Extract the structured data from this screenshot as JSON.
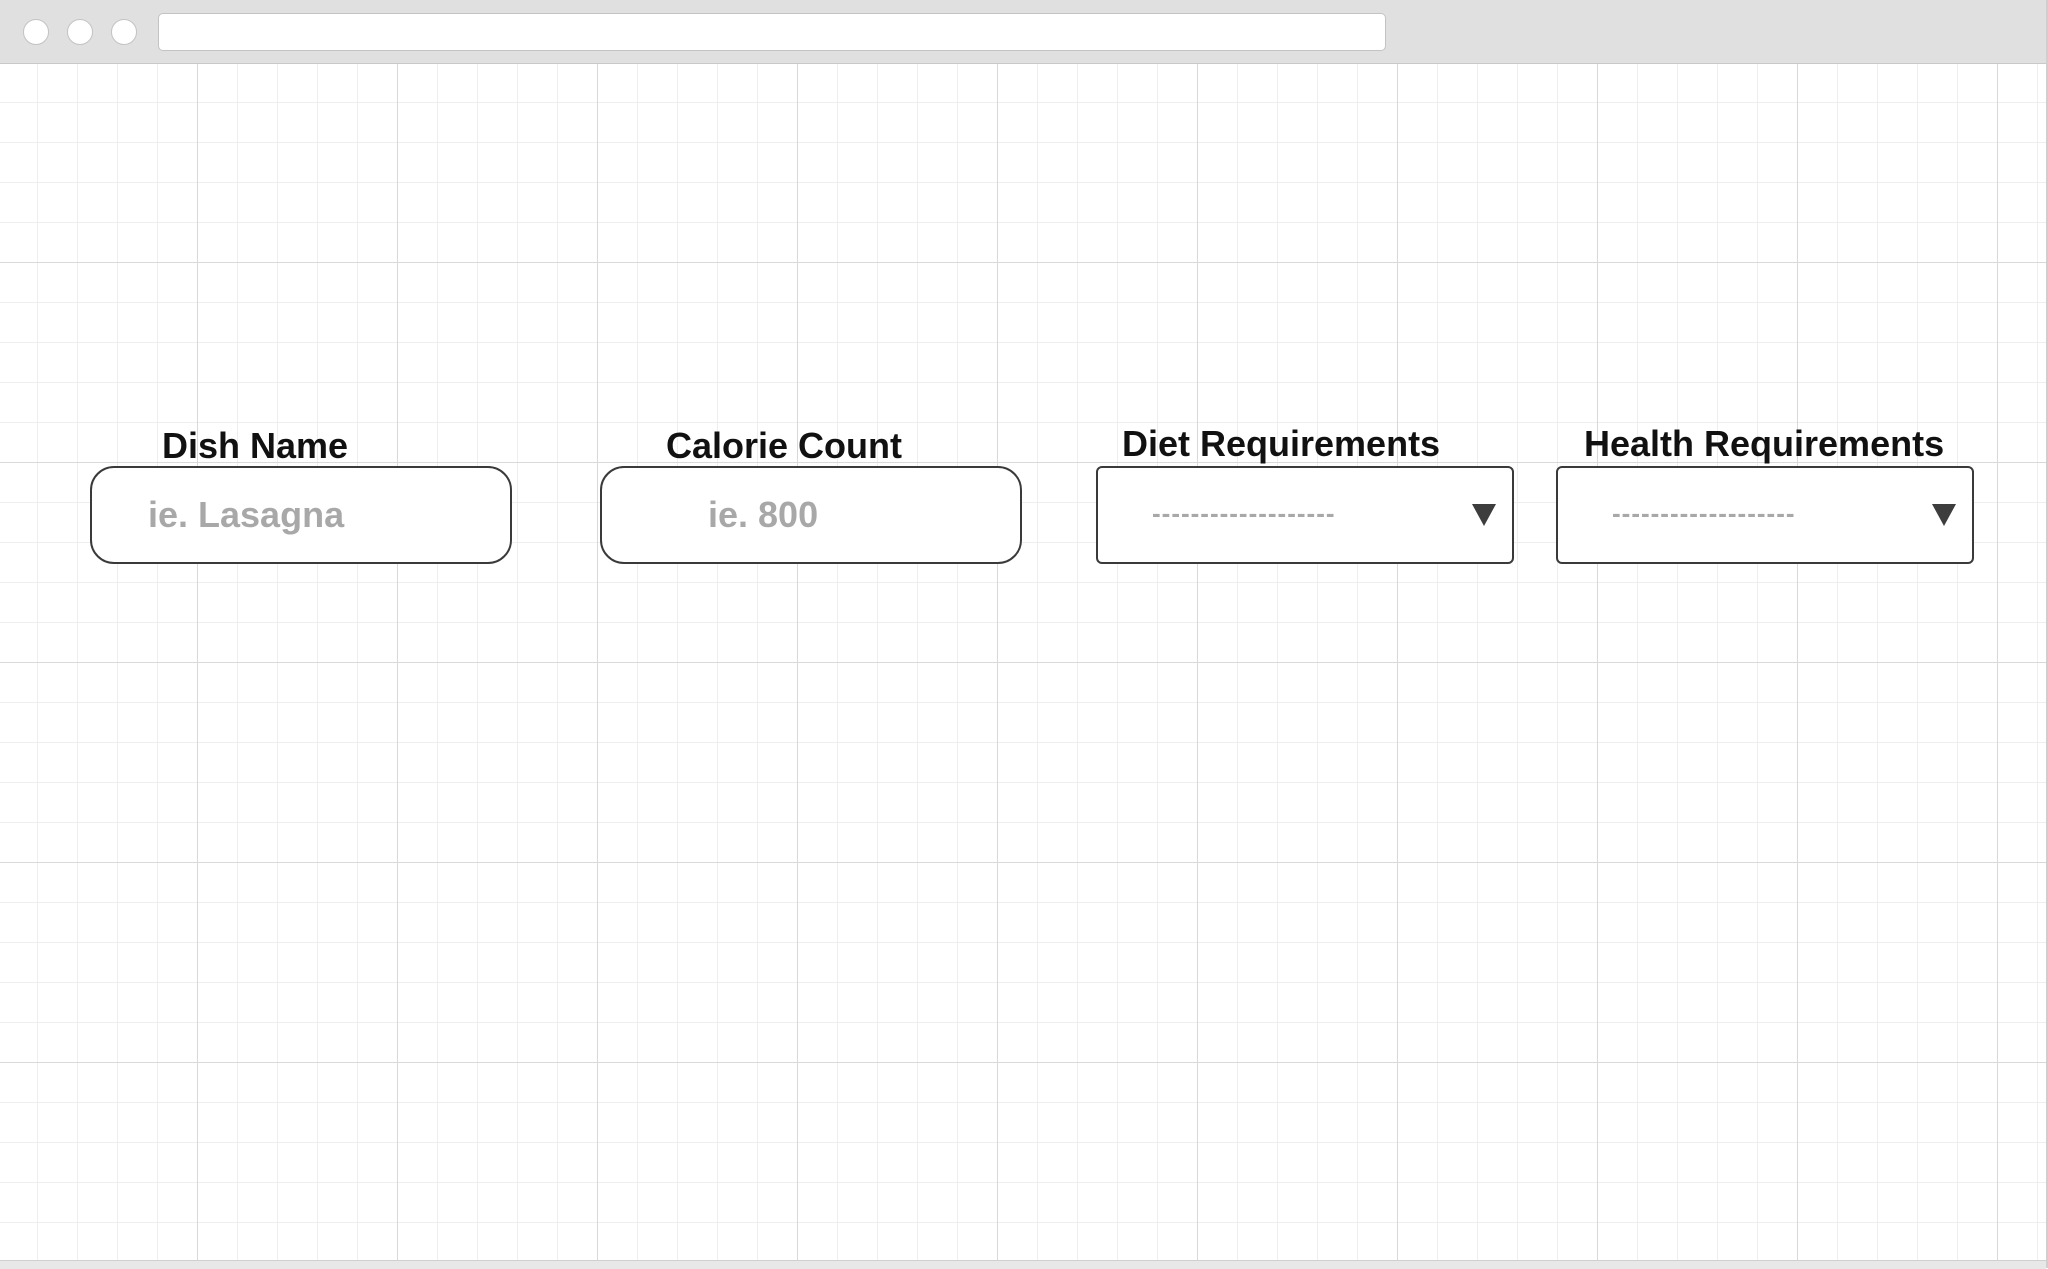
{
  "browser": {
    "url": ""
  },
  "form": {
    "dish_name": {
      "label": "Dish Name",
      "value": "",
      "placeholder": "ie. Lasagna"
    },
    "calorie_count": {
      "label": "Calorie Count",
      "value": "",
      "placeholder": "ie. 800"
    },
    "diet_requirements": {
      "label": "Diet Requirements",
      "selected": "-------------------",
      "arrow_icon": "dropdown-triangle"
    },
    "health_requirements": {
      "label": "Health Requirements",
      "selected": "-------------------",
      "arrow_icon": "dropdown-triangle"
    }
  }
}
